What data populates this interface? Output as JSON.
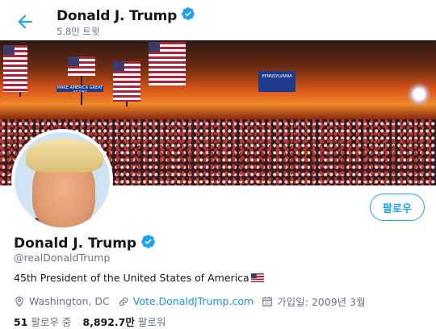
{
  "header": {
    "title": "Donald J. Trump",
    "tweet_count": "5.8만 트윗"
  },
  "banner": {
    "sign_main": "PENNSYLVANIA",
    "sign_left": "MAKE AMERICA GREAT AGAIN!"
  },
  "profile": {
    "display_name": "Donald J. Trump",
    "handle": "@realDonaldTrump",
    "bio": "45th President of the United States of America",
    "location": "Washington, DC",
    "website": "Vote.DonaldJTrump.com",
    "joined": "가입일: 2009년 3월",
    "follow_button": "팔로우"
  },
  "stats": {
    "following_count": "51",
    "following_label": "팔로우 중",
    "followers_count": "8,892.7만",
    "followers_label": "팔로워"
  },
  "colors": {
    "accent": "#1da1f2",
    "link": "#1b95e0",
    "muted": "#657786"
  },
  "icons": [
    "back-arrow-icon",
    "verified-badge-icon",
    "location-pin-icon",
    "link-icon",
    "calendar-icon",
    "us-flag-emoji"
  ]
}
